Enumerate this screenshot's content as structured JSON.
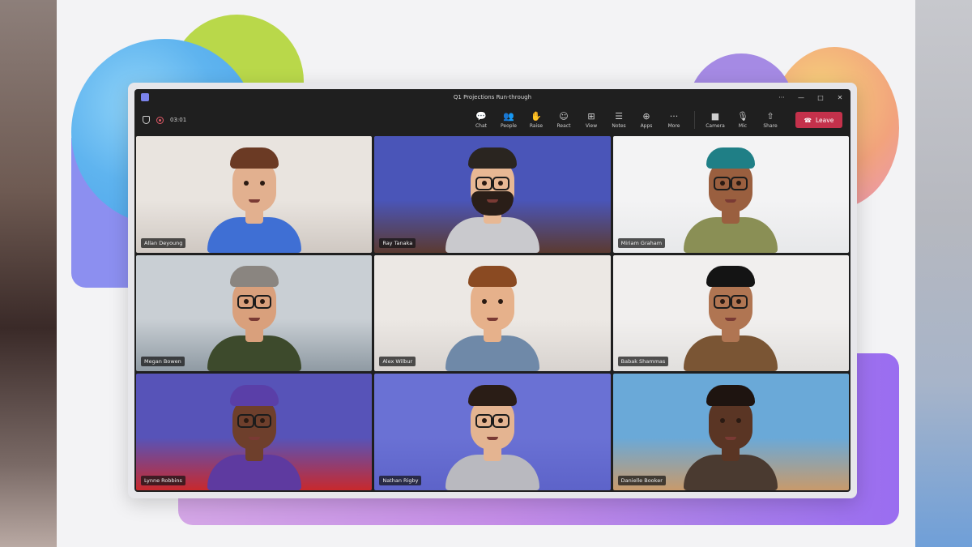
{
  "window": {
    "title": "Q1 Projections Run-through"
  },
  "window_controls": [
    "···",
    "—",
    "□",
    "✕"
  ],
  "meeting": {
    "timer": "03:01"
  },
  "toolbar": {
    "items": [
      {
        "label": "Chat",
        "glyph": "💬",
        "icon": "chat-icon"
      },
      {
        "label": "People",
        "glyph": "👥",
        "icon": "people-icon"
      },
      {
        "label": "Raise",
        "glyph": "✋",
        "icon": "raise-hand-icon"
      },
      {
        "label": "React",
        "glyph": "☺",
        "icon": "react-icon"
      },
      {
        "label": "View",
        "glyph": "⊞",
        "icon": "view-icon"
      },
      {
        "label": "Notes",
        "glyph": "☰",
        "icon": "notes-icon"
      },
      {
        "label": "Apps",
        "glyph": "⊕",
        "icon": "apps-icon"
      },
      {
        "label": "More",
        "glyph": "···",
        "icon": "more-icon"
      }
    ],
    "devices": [
      {
        "label": "Camera",
        "glyph": "■",
        "icon": "camera-icon"
      },
      {
        "label": "Mic",
        "glyph": "🎙",
        "icon": "mic-icon"
      },
      {
        "label": "Share",
        "glyph": "⇧",
        "icon": "share-icon"
      }
    ],
    "leave_label": "Leave"
  },
  "participants": [
    {
      "name": "Allan Deyoung",
      "bg": "#cfc8c2",
      "wall": "#e9e4df",
      "skin": "#e2b08f",
      "hair": "#6b3a24",
      "shirt": "#3f6fd4",
      "glasses": false,
      "beard": false
    },
    {
      "name": "Ray Tanaka",
      "bg": "#5b3a30",
      "wall": "#4a55b8",
      "skin": "#e8b894",
      "hair": "#2a2520",
      "shirt": "#c9c9cd",
      "glasses": true,
      "beard": true
    },
    {
      "name": "Miriam Graham",
      "bg": "#e7e8ea",
      "wall": "#f3f3f4",
      "skin": "#9a5f3f",
      "hair": "#1f7f86",
      "shirt": "#8a8f55",
      "glasses": true,
      "beard": false
    },
    {
      "name": "Megan Bowen",
      "bg": "#8f9aa3",
      "wall": "#c9cfd4",
      "skin": "#d9a07c",
      "hair": "#8a8580",
      "shirt": "#3d4a2c",
      "glasses": true,
      "beard": false
    },
    {
      "name": "Alex Wilbur",
      "bg": "#d8d3cf",
      "wall": "#ece8e4",
      "skin": "#e6b18b",
      "hair": "#8a4a22",
      "shirt": "#6f89a8",
      "glasses": false,
      "beard": false
    },
    {
      "name": "Babak Shammas",
      "bg": "#e1dfdd",
      "wall": "#f1efee",
      "skin": "#b07552",
      "hair": "#141414",
      "shirt": "#7a5534",
      "glasses": true,
      "beard": false
    },
    {
      "name": "Lynne Robbins",
      "bg": "#c8292d",
      "wall": "#5753b8",
      "skin": "#6e3f2c",
      "hair": "#5a3fa8",
      "shirt": "#5e3aa0",
      "glasses": true,
      "beard": false
    },
    {
      "name": "Nathan Rigby",
      "bg": "#5d63c9",
      "wall": "#6a71d4",
      "skin": "#e4b491",
      "hair": "#2a1d16",
      "shirt": "#b9b9bf",
      "glasses": true,
      "beard": false
    },
    {
      "name": "Danielle Booker",
      "bg": "#c89a6b",
      "wall": "#6aa9d8",
      "skin": "#5a3524",
      "hair": "#1e1410",
      "shirt": "#4a3a30",
      "glasses": false,
      "beard": false
    }
  ]
}
